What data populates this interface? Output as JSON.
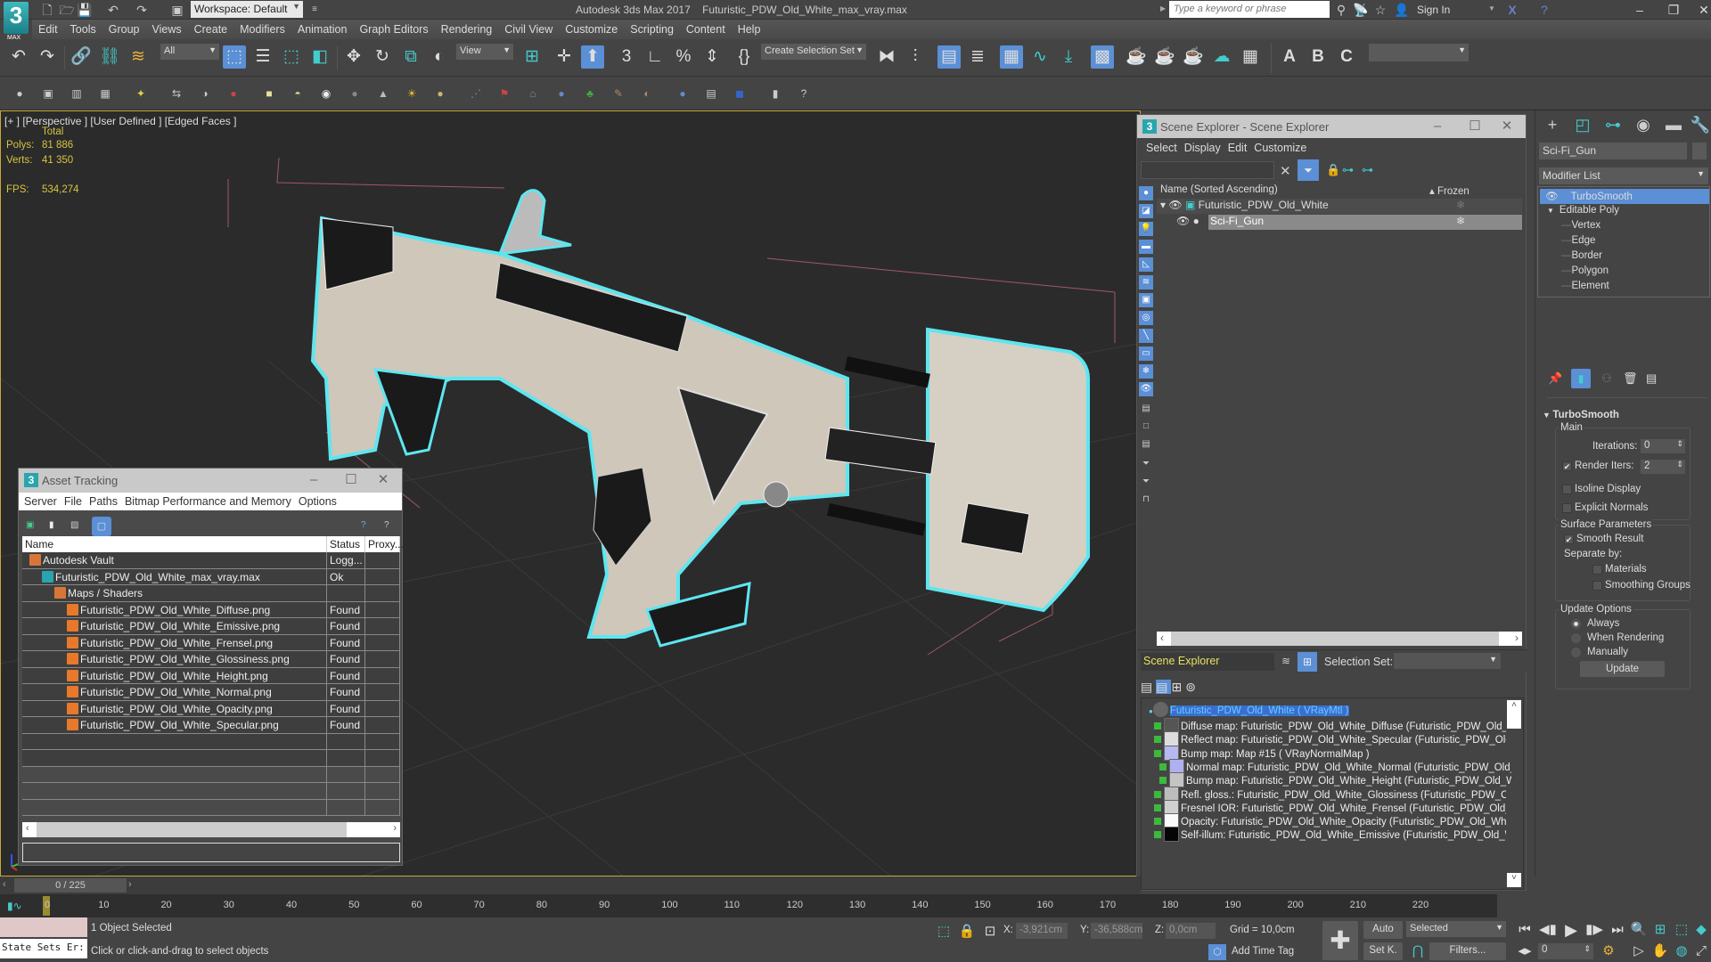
{
  "app": {
    "title": "Autodesk 3ds Max 2017",
    "file": "Futuristic_PDW_Old_White_max_vray.max",
    "workspace": "Workspace: Default",
    "search_placeholder": "Type a keyword or phrase",
    "sign_in": "Sign In",
    "logo": "3",
    "logo_sub": "MAX"
  },
  "menu": [
    "Edit",
    "Tools",
    "Group",
    "Views",
    "Create",
    "Modifiers",
    "Animation",
    "Graph Editors",
    "Rendering",
    "Civil View",
    "Customize",
    "Scripting",
    "Content",
    "Help"
  ],
  "toolbar": {
    "selection_filter": "All",
    "ref_coord": "View",
    "create_selection_set": "Create Selection Set",
    "named_set": ""
  },
  "viewport": {
    "label": "[+ ] [Perspective ]  [User Defined ] [Edged Faces ]",
    "stats_header": "Total",
    "polys_label": "Polys:",
    "polys": "81 886",
    "verts_label": "Verts:",
    "verts": "41 350",
    "fps_label": "FPS:",
    "fps": "534,274"
  },
  "asset_tracking": {
    "title": "Asset Tracking",
    "menu": [
      "Server",
      "File",
      "Paths",
      "Bitmap Performance and Memory",
      "Options"
    ],
    "columns": [
      "Name",
      "Status",
      "Proxy..."
    ],
    "rows": [
      {
        "name": "Autodesk Vault",
        "status": "Logg...",
        "proxy": "",
        "indent": 0,
        "icon": "vault"
      },
      {
        "name": "Futuristic_PDW_Old_White_max_vray.max",
        "status": "Ok",
        "proxy": "",
        "indent": 1,
        "icon": "max"
      },
      {
        "name": "Maps / Shaders",
        "status": "",
        "proxy": "",
        "indent": 2,
        "icon": "vault"
      },
      {
        "name": "Futuristic_PDW_Old_White_Diffuse.png",
        "status": "Found",
        "proxy": "",
        "indent": 3,
        "icon": "png"
      },
      {
        "name": "Futuristic_PDW_Old_White_Emissive.png",
        "status": "Found",
        "proxy": "",
        "indent": 3,
        "icon": "png"
      },
      {
        "name": "Futuristic_PDW_Old_White_Frensel.png",
        "status": "Found",
        "proxy": "",
        "indent": 3,
        "icon": "png"
      },
      {
        "name": "Futuristic_PDW_Old_White_Glossiness.png",
        "status": "Found",
        "proxy": "",
        "indent": 3,
        "icon": "png"
      },
      {
        "name": "Futuristic_PDW_Old_White_Height.png",
        "status": "Found",
        "proxy": "",
        "indent": 3,
        "icon": "png"
      },
      {
        "name": "Futuristic_PDW_Old_White_Normal.png",
        "status": "Found",
        "proxy": "",
        "indent": 3,
        "icon": "png"
      },
      {
        "name": "Futuristic_PDW_Old_White_Opacity.png",
        "status": "Found",
        "proxy": "",
        "indent": 3,
        "icon": "png"
      },
      {
        "name": "Futuristic_PDW_Old_White_Specular.png",
        "status": "Found",
        "proxy": "",
        "indent": 3,
        "icon": "png"
      }
    ],
    "empty_rows": 5
  },
  "scene_explorer": {
    "title": "Scene Explorer - Scene Explorer",
    "menu": [
      "Select",
      "Display",
      "Edit",
      "Customize"
    ],
    "col_name": "Name (Sorted Ascending)",
    "col_frozen": "Frozen",
    "nodes": [
      {
        "name": "Futuristic_PDW_Old_White",
        "level": 0,
        "selected": false
      },
      {
        "name": "Sci-Fi_Gun",
        "level": 1,
        "selected": true
      }
    ],
    "explorer_name": "Scene Explorer",
    "selection_set_label": "Selection Set:",
    "selection_set_value": ""
  },
  "material_tree": {
    "root": "Futuristic_PDW_Old_White  ( VRayMtl )",
    "items": [
      {
        "text": "Diffuse map: Futuristic_PDW_Old_White_Diffuse (Futuristic_PDW_Old_White_Diffuse.png)",
        "level": 0,
        "swatch": "#555"
      },
      {
        "text": "Reflect map: Futuristic_PDW_Old_White_Specular (Futuristic_PDW_Old_White_Specular.png)",
        "level": 0,
        "swatch": "#ddd"
      },
      {
        "text": "Bump map: Map #15  ( VRayNormalMap )",
        "level": 0,
        "swatch": "#b8b8f0"
      },
      {
        "text": "Normal map: Futuristic_PDW_Old_White_Normal (Futuristic_PDW_Old_White_Normal.png)",
        "level": 1,
        "swatch": "#b0b0f0"
      },
      {
        "text": "Bump map: Futuristic_PDW_Old_White_Height (Futuristic_PDW_Old_White_Height.png)",
        "level": 1,
        "swatch": "#c4c4c4"
      },
      {
        "text": "Refl. gloss.: Futuristic_PDW_Old_White_Glossiness (Futuristic_PDW_Old_White_Glossiness.png)",
        "level": 0,
        "swatch": "#bdbdbd"
      },
      {
        "text": "Fresnel IOR: Futuristic_PDW_Old_White_Frensel (Futuristic_PDW_Old_White_Frensel.png)",
        "level": 0,
        "swatch": "#d0d0d0"
      },
      {
        "text": "Opacity: Futuristic_PDW_Old_White_Opacity (Futuristic_PDW_Old_White_Opacity.png)",
        "level": 0,
        "swatch": "#fafafa"
      },
      {
        "text": "Self-illum: Futuristic_PDW_Old_White_Emissive (Futuristic_PDW_Old_White_Emissive.png)",
        "level": 0,
        "swatch": "#050505"
      }
    ]
  },
  "command_panel": {
    "object_name": "Sci-Fi_Gun",
    "modifier_list": "Modifier List",
    "stack": [
      {
        "name": "TurboSmooth",
        "active": true,
        "level": 0
      },
      {
        "name": "Editable Poly",
        "active": false,
        "level": 0
      },
      {
        "name": "Vertex",
        "active": false,
        "level": 1
      },
      {
        "name": "Edge",
        "active": false,
        "level": 1
      },
      {
        "name": "Border",
        "active": false,
        "level": 1
      },
      {
        "name": "Polygon",
        "active": false,
        "level": 1
      },
      {
        "name": "Element",
        "active": false,
        "level": 1
      }
    ],
    "rollout_title": "TurboSmooth",
    "main_group": "Main",
    "iterations_label": "Iterations:",
    "iterations": "0",
    "render_iters_label": "Render Iters:",
    "render_iters": "2",
    "render_iters_checked": true,
    "isoline_label": "Isoline Display",
    "isoline_checked": false,
    "explicit_normals_label": "Explicit Normals",
    "explicit_normals_checked": false,
    "surface_group": "Surface Parameters",
    "smooth_result_label": "Smooth Result",
    "smooth_result_checked": true,
    "separate_by_label": "Separate by:",
    "materials_label": "Materials",
    "smoothing_groups_label": "Smoothing Groups",
    "update_group": "Update Options",
    "update_options": [
      "Always",
      "When Rendering",
      "Manually"
    ],
    "update_selected": "Always",
    "update_button": "Update"
  },
  "timeline": {
    "frame_display": "0 / 225",
    "current_frame": 0,
    "total_frames": 225,
    "ticks": [
      "0",
      "10",
      "20",
      "30",
      "40",
      "50",
      "60",
      "70",
      "80",
      "90",
      "100",
      "110",
      "120",
      "130",
      "140",
      "150",
      "160",
      "170",
      "180",
      "190",
      "200",
      "210",
      "220"
    ]
  },
  "status": {
    "maxscript_listener": "State Sets Er:",
    "selected": "1 Object Selected",
    "prompt": "Click or click-and-drag to select objects",
    "x_label": "X:",
    "x": "-3,921cm",
    "y_label": "Y:",
    "y": "-36,588cm",
    "z_label": "Z:",
    "z": "0,0cm",
    "grid": "Grid = 10,0cm",
    "add_time_tag": "Add Time Tag",
    "auto_key": "Auto",
    "set_key": "Set K.",
    "key_filter_select": "Selected",
    "filters": "Filters...",
    "frame_field": "0"
  },
  "colors": {
    "accent": "#5b8fd6",
    "teal": "#2aa5ad",
    "stat_yellow": "#d7c440",
    "selection_outline": "#5ee6f0"
  }
}
